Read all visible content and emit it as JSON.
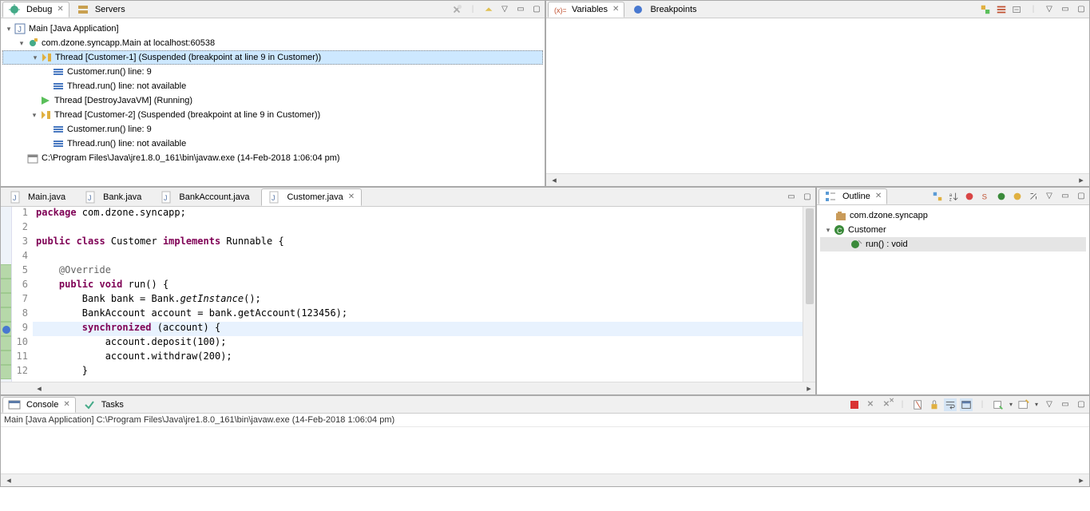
{
  "debug": {
    "tabs": {
      "debug": "Debug",
      "servers": "Servers"
    },
    "nodes": {
      "app": "Main [Java Application]",
      "vm": "com.dzone.syncapp.Main at localhost:60538",
      "t1": "Thread [Customer-1] (Suspended (breakpoint at line 9 in Customer))",
      "t1f1": "Customer.run() line: 9",
      "t1f2": "Thread.run() line: not available",
      "t2": "Thread [DestroyJavaVM] (Running)",
      "t3": "Thread [Customer-2] (Suspended (breakpoint at line 9 in Customer))",
      "t3f1": "Customer.run() line: 9",
      "t3f2": "Thread.run() line: not available",
      "term": "C:\\Program Files\\Java\\jre1.8.0_161\\bin\\javaw.exe (14-Feb-2018 1:06:04 pm)"
    }
  },
  "vars": {
    "tabs": {
      "variables": "Variables",
      "breakpoints": "Breakpoints"
    }
  },
  "editor": {
    "tabs": {
      "main": "Main.java",
      "bank": "Bank.java",
      "bankaccount": "BankAccount.java",
      "customer": "Customer.java"
    },
    "lines": [
      "1",
      "2",
      "3",
      "4",
      "5",
      "6",
      "7",
      "8",
      "9",
      "10",
      "11",
      "12"
    ]
  },
  "outline": {
    "title": "Outline",
    "pkg": "com.dzone.syncapp",
    "cls": "Customer",
    "method": "run() : void"
  },
  "console": {
    "tabs": {
      "console": "Console",
      "tasks": "Tasks"
    },
    "status": "Main [Java Application] C:\\Program Files\\Java\\jre1.8.0_161\\bin\\javaw.exe (14-Feb-2018 1:06:04 pm)"
  }
}
